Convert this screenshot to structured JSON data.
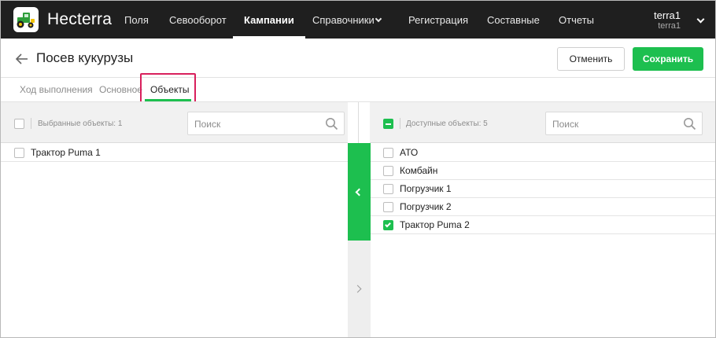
{
  "app": {
    "brand": "Hecterra",
    "logo_icon": "tractor-logo-icon"
  },
  "nav": {
    "items": [
      {
        "label": "Поля"
      },
      {
        "label": "Севооборот"
      },
      {
        "label": "Кампании",
        "active": true
      },
      {
        "label": "Справочники",
        "has_dropdown": true
      },
      {
        "label": "Регистрация"
      },
      {
        "label": "Составные"
      },
      {
        "label": "Отчеты"
      }
    ]
  },
  "user": {
    "name": "terra1",
    "account": "terra1"
  },
  "header": {
    "title": "Посев кукурузы",
    "cancel_label": "Отменить",
    "save_label": "Сохранить"
  },
  "tabs": [
    {
      "label": "Ход выполнения"
    },
    {
      "label": "Основное"
    },
    {
      "label": "Объекты",
      "active": true
    }
  ],
  "selected_panel": {
    "label": "Выбранные объекты: 1",
    "search_placeholder": "Поиск",
    "items": [
      {
        "label": "Трактор Puma 1",
        "checked": false
      }
    ]
  },
  "available_panel": {
    "label": "Доступные объекты: 5",
    "search_placeholder": "Поиск",
    "items": [
      {
        "label": "АТО",
        "checked": false
      },
      {
        "label": "Комбайн",
        "checked": false
      },
      {
        "label": "Погрузчик 1",
        "checked": false
      },
      {
        "label": "Погрузчик 2",
        "checked": false
      },
      {
        "label": "Трактор Puma 2",
        "checked": true
      }
    ]
  },
  "colors": {
    "accent": "#1dbf4f",
    "topbar": "#1f1f1f",
    "highlight": "#d8205c"
  }
}
